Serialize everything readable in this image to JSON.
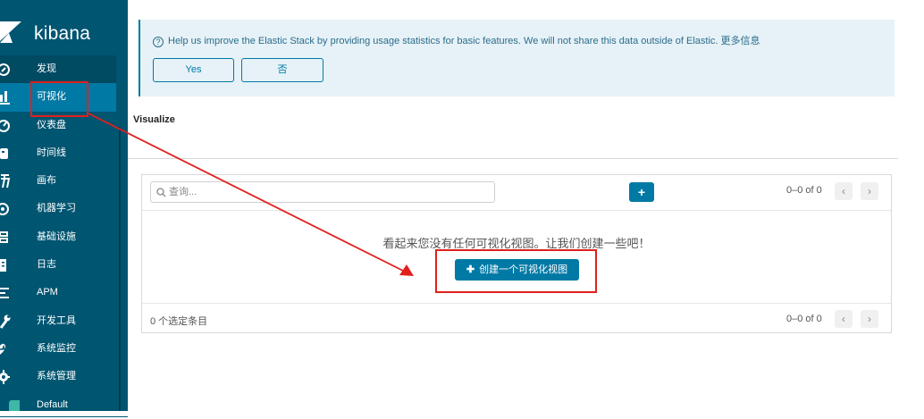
{
  "brand": {
    "title": "kibana",
    "logo": "kibana-logo-icon"
  },
  "colors": {
    "sidebar": "#005571",
    "active": "#0079a5",
    "accent": "#0079a5",
    "annotation": "#e0201d",
    "banner_bg": "#e6f2f7"
  },
  "sidebar": {
    "items": [
      {
        "label": "发现",
        "icon": "compass-icon"
      },
      {
        "label": "可视化",
        "icon": "bar-chart-icon",
        "active": true
      },
      {
        "label": "仪表盘",
        "icon": "dashboard-icon"
      },
      {
        "label": "时间线",
        "icon": "timeline-icon"
      },
      {
        "label": "画布",
        "icon": "canvas-icon"
      },
      {
        "label": "机器学习",
        "icon": "machine-learning-icon"
      },
      {
        "label": "基础设施",
        "icon": "infrastructure-icon"
      },
      {
        "label": "日志",
        "icon": "logs-icon"
      },
      {
        "label": "APM",
        "icon": "apm-icon"
      },
      {
        "label": "开发工具",
        "icon": "wrench-icon"
      },
      {
        "label": "系统监控",
        "icon": "heartbeat-icon"
      },
      {
        "label": "系统管理",
        "icon": "gear-icon"
      },
      {
        "label": "Default",
        "icon": "space-avatar-icon"
      }
    ]
  },
  "banner": {
    "message": "Help us improve the Elastic Stack by providing usage statistics for basic features. We will not share this data outside of Elastic. 更多信息",
    "yes_label": "Yes",
    "no_label": "否"
  },
  "page": {
    "title": "Visualize"
  },
  "list": {
    "search_placeholder": "查询...",
    "add_label": "+",
    "pager_text": "0–0 of 0",
    "empty_message": "看起来您没有任何可视化视图。让我们创建一些吧！",
    "create_label": "创建一个可视化视图",
    "selected_count": "0 个选定条目",
    "footer_pager_text": "0–0 of 0"
  }
}
